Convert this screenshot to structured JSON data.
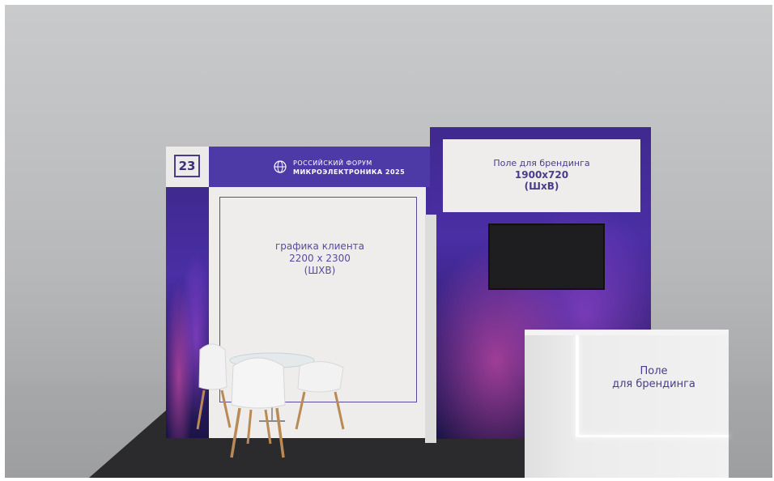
{
  "booth": {
    "number": "23",
    "logo_line1": "РОССИЙСКИЙ ФОРУМ",
    "logo_line2": "МИКРОЭЛЕКТРОНИКА 2025"
  },
  "client_panel": {
    "line1": "графика клиента",
    "line2": "2200 x 2300",
    "line3": "(ШХВ)"
  },
  "branding_top": {
    "line1": "Поле  для брендинга",
    "line2": "1900x720",
    "line3": "(ШxВ)"
  },
  "counter": {
    "line1": "Поле",
    "line2": "для брендинга"
  },
  "colors": {
    "brand_purple": "#4a2ea5",
    "text_purple": "#4a3b8c",
    "panel_white": "#eeedeb"
  }
}
